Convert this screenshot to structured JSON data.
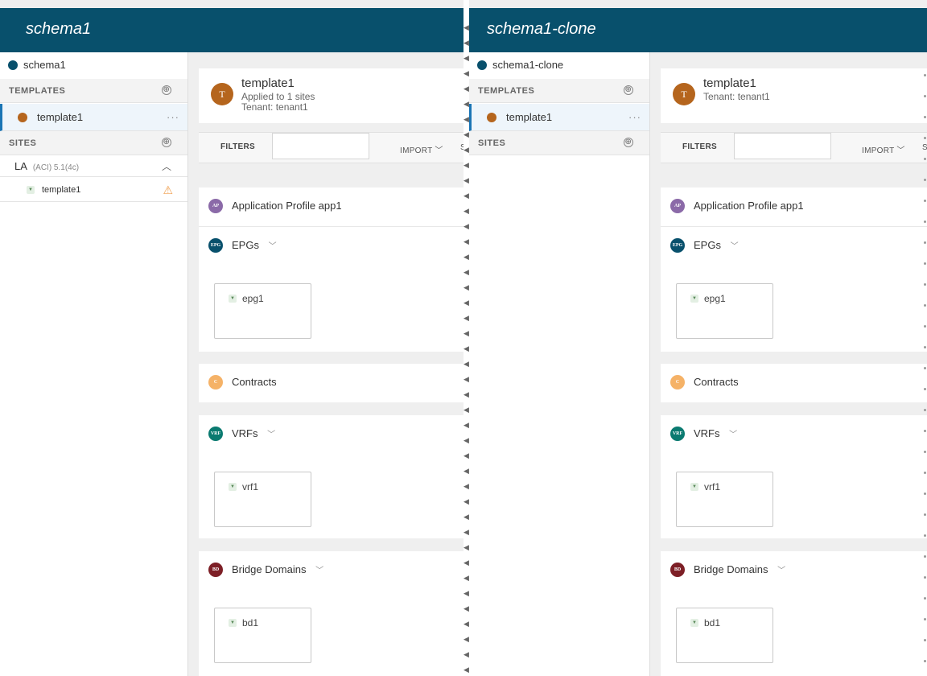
{
  "left": {
    "title": "schema1",
    "sidebar": {
      "schema_name": "schema1",
      "templates_label": "TEMPLATES",
      "template_item": "template1",
      "sites_label": "SITES",
      "site": {
        "name": "LA",
        "sub": "(ACI) 5.1(4c)",
        "template": "template1"
      }
    },
    "template": {
      "avatar": "T",
      "name": "template1",
      "applied": "Applied to 1 sites",
      "tenant": "Tenant: tenant1"
    },
    "filters_label": "FILTERS",
    "import_label": "IMPORT",
    "sort_label": "SORT",
    "sections": {
      "ap": {
        "badge": "AP",
        "title": "Application Profile app1",
        "color": "#8b6aa8"
      },
      "epgs": {
        "badge": "EPG",
        "title": "EPGs",
        "item": "epg1",
        "color": "#08506c"
      },
      "contracts": {
        "badge": "C",
        "title": "Contracts",
        "color": "#f5b267"
      },
      "vrfs": {
        "badge": "VRF",
        "title": "VRFs",
        "item": "vrf1",
        "color": "#0a7a70"
      },
      "bds": {
        "badge": "BD",
        "title": "Bridge Domains",
        "item": "bd1",
        "color": "#7d1f26"
      }
    }
  },
  "right": {
    "title": "schema1-clone",
    "sidebar": {
      "schema_name": "schema1-clone",
      "templates_label": "TEMPLATES",
      "template_item": "template1",
      "sites_label": "SITES"
    },
    "template": {
      "avatar": "T",
      "name": "template1",
      "tenant": "Tenant: tenant1"
    },
    "filters_label": "FILTERS",
    "import_label": "IMPORT",
    "sort_label": "SORT",
    "sections": {
      "ap": {
        "badge": "AP",
        "title": "Application Profile app1",
        "color": "#8b6aa8"
      },
      "epgs": {
        "badge": "EPG",
        "title": "EPGs",
        "item": "epg1",
        "color": "#08506c"
      },
      "contracts": {
        "badge": "C",
        "title": "Contracts",
        "color": "#f5b267"
      },
      "vrfs": {
        "badge": "VRF",
        "title": "VRFs",
        "item": "vrf1",
        "color": "#0a7a70"
      },
      "bds": {
        "badge": "BD",
        "title": "Bridge Domains",
        "item": "bd1",
        "color": "#7d1f26"
      }
    }
  },
  "icons": {
    "plus": "⊕",
    "more": "···",
    "chevron_down": "﹀",
    "chevron_up": "︿",
    "warning": "⚠",
    "shield": "▼",
    "divider_arrow": "◀"
  }
}
